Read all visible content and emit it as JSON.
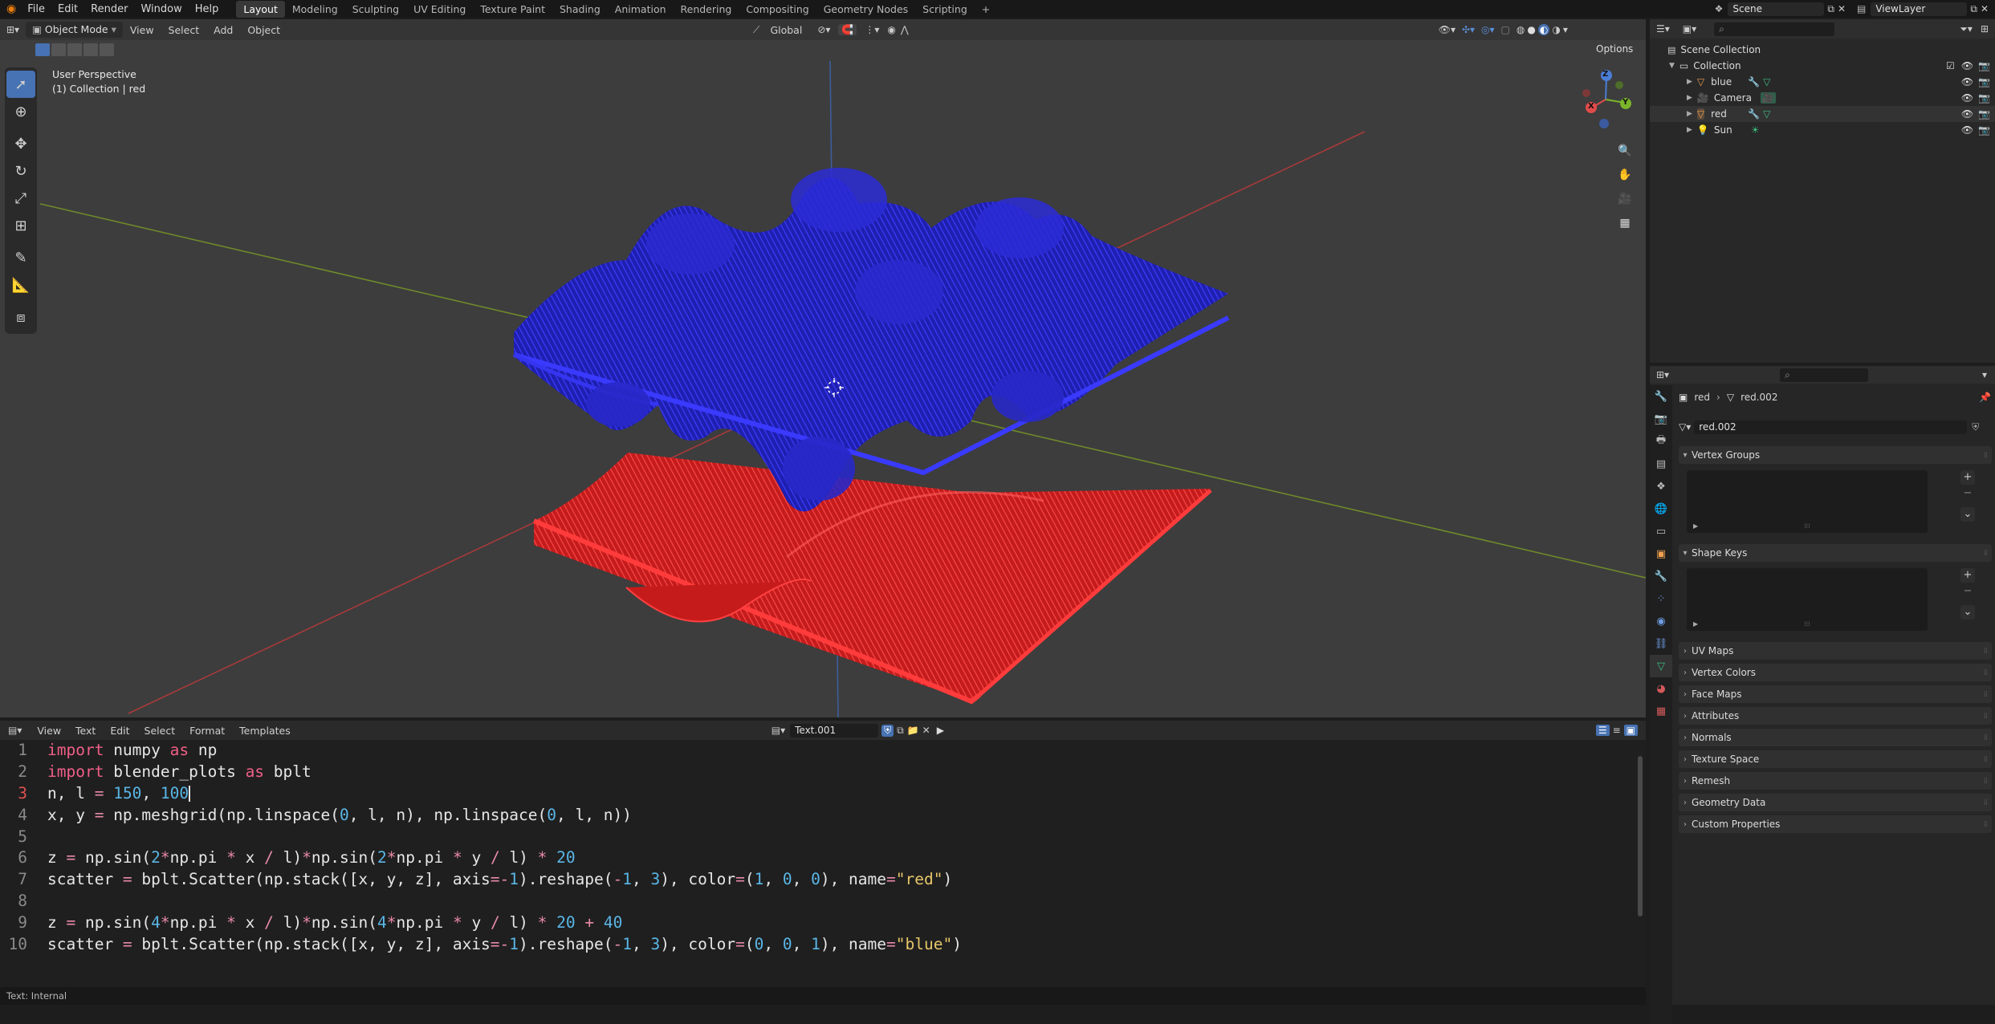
{
  "menu": {
    "items": [
      "File",
      "Edit",
      "Render",
      "Window",
      "Help"
    ],
    "workspaces": [
      "Layout",
      "Modeling",
      "Sculpting",
      "UV Editing",
      "Texture Paint",
      "Shading",
      "Animation",
      "Rendering",
      "Compositing",
      "Geometry Nodes",
      "Scripting"
    ],
    "active_workspace": "Layout",
    "add_tab": "+",
    "scene": "Scene",
    "view_layer": "ViewLayer"
  },
  "viewport": {
    "mode": "Object Mode",
    "menus": [
      "View",
      "Select",
      "Add",
      "Object"
    ],
    "transform_orientation": "Global",
    "options": "Options",
    "info_line1": "User Perspective",
    "info_line2": "(1) Collection | red",
    "gizmo": {
      "z": "Z",
      "y": "Y",
      "x": "X"
    },
    "colors": {
      "blue_mesh": "#2d2de0",
      "red_mesh": "#e02525",
      "background": "#3d3d3d"
    }
  },
  "text_editor": {
    "menus": [
      "View",
      "Text",
      "Edit",
      "Select",
      "Format",
      "Templates"
    ],
    "datablock": "Text.001",
    "status": "Text: Internal",
    "line_numbers": [
      "1",
      "2",
      "3",
      "4",
      "5",
      "6",
      "7",
      "8",
      "9",
      "10"
    ],
    "lines": [
      [
        [
          "kw",
          "import"
        ],
        [
          "plain",
          " numpy "
        ],
        [
          "kw",
          "as"
        ],
        [
          "plain",
          " np"
        ]
      ],
      [
        [
          "kw",
          "import"
        ],
        [
          "plain",
          " blender_plots "
        ],
        [
          "kw",
          "as"
        ],
        [
          "plain",
          " bplt"
        ]
      ],
      [
        [
          "plain",
          "n, l "
        ],
        [
          "op",
          "="
        ],
        [
          "plain",
          " "
        ],
        [
          "num",
          "150"
        ],
        [
          "plain",
          ", "
        ],
        [
          "num",
          "100"
        ]
      ],
      [
        [
          "plain",
          "x, y "
        ],
        [
          "op",
          "="
        ],
        [
          "plain",
          " np.meshgrid(np.linspace("
        ],
        [
          "num",
          "0"
        ],
        [
          "plain",
          ", l, n), np.linspace("
        ],
        [
          "num",
          "0"
        ],
        [
          "plain",
          ", l, n))"
        ]
      ],
      [],
      [
        [
          "plain",
          "z "
        ],
        [
          "op",
          "="
        ],
        [
          "plain",
          " np.sin("
        ],
        [
          "num",
          "2"
        ],
        [
          "op",
          "*"
        ],
        [
          "plain",
          "np.pi "
        ],
        [
          "op",
          "*"
        ],
        [
          "plain",
          " x "
        ],
        [
          "op",
          "/"
        ],
        [
          "plain",
          " l)"
        ],
        [
          "op",
          "*"
        ],
        [
          "plain",
          "np.sin("
        ],
        [
          "num",
          "2"
        ],
        [
          "op",
          "*"
        ],
        [
          "plain",
          "np.pi "
        ],
        [
          "op",
          "*"
        ],
        [
          "plain",
          " y "
        ],
        [
          "op",
          "/"
        ],
        [
          "plain",
          " l) "
        ],
        [
          "op",
          "*"
        ],
        [
          "plain",
          " "
        ],
        [
          "num",
          "20"
        ]
      ],
      [
        [
          "plain",
          "scatter "
        ],
        [
          "op",
          "="
        ],
        [
          "plain",
          " bplt.Scatter(np.stack([x, y, z], axis"
        ],
        [
          "op",
          "="
        ],
        [
          "op",
          "-"
        ],
        [
          "num",
          "1"
        ],
        [
          "plain",
          ").reshape("
        ],
        [
          "op",
          "-"
        ],
        [
          "num",
          "1"
        ],
        [
          "plain",
          ", "
        ],
        [
          "num",
          "3"
        ],
        [
          "plain",
          "), color"
        ],
        [
          "op",
          "="
        ],
        [
          "plain",
          "("
        ],
        [
          "num",
          "1"
        ],
        [
          "plain",
          ", "
        ],
        [
          "num",
          "0"
        ],
        [
          "plain",
          ", "
        ],
        [
          "num",
          "0"
        ],
        [
          "plain",
          "), name"
        ],
        [
          "op",
          "="
        ],
        [
          "str",
          "\"red\""
        ],
        [
          "plain",
          ")"
        ]
      ],
      [],
      [
        [
          "plain",
          "z "
        ],
        [
          "op",
          "="
        ],
        [
          "plain",
          " np.sin("
        ],
        [
          "num",
          "4"
        ],
        [
          "op",
          "*"
        ],
        [
          "plain",
          "np.pi "
        ],
        [
          "op",
          "*"
        ],
        [
          "plain",
          " x "
        ],
        [
          "op",
          "/"
        ],
        [
          "plain",
          " l)"
        ],
        [
          "op",
          "*"
        ],
        [
          "plain",
          "np.sin("
        ],
        [
          "num",
          "4"
        ],
        [
          "op",
          "*"
        ],
        [
          "plain",
          "np.pi "
        ],
        [
          "op",
          "*"
        ],
        [
          "plain",
          " y "
        ],
        [
          "op",
          "/"
        ],
        [
          "plain",
          " l) "
        ],
        [
          "op",
          "*"
        ],
        [
          "plain",
          " "
        ],
        [
          "num",
          "20"
        ],
        [
          "plain",
          " "
        ],
        [
          "op",
          "+"
        ],
        [
          "plain",
          " "
        ],
        [
          "num",
          "40"
        ]
      ],
      [
        [
          "plain",
          "scatter "
        ],
        [
          "op",
          "="
        ],
        [
          "plain",
          " bplt.Scatter(np.stack([x, y, z], axis"
        ],
        [
          "op",
          "="
        ],
        [
          "op",
          "-"
        ],
        [
          "num",
          "1"
        ],
        [
          "plain",
          ").reshape("
        ],
        [
          "op",
          "-"
        ],
        [
          "num",
          "1"
        ],
        [
          "plain",
          ", "
        ],
        [
          "num",
          "3"
        ],
        [
          "plain",
          "), color"
        ],
        [
          "op",
          "="
        ],
        [
          "plain",
          "("
        ],
        [
          "num",
          "0"
        ],
        [
          "plain",
          ", "
        ],
        [
          "num",
          "0"
        ],
        [
          "plain",
          ", "
        ],
        [
          "num",
          "1"
        ],
        [
          "plain",
          "), name"
        ],
        [
          "op",
          "="
        ],
        [
          "str",
          "\"blue\""
        ],
        [
          "plain",
          ")"
        ]
      ]
    ]
  },
  "outliner": {
    "scene_collection": "Scene Collection",
    "collection": "Collection",
    "objects": [
      "blue",
      "Camera",
      "red",
      "Sun"
    ]
  },
  "properties": {
    "object": "red",
    "mesh": "red.002",
    "mesh_field": "red.002",
    "vertex_groups": "Vertex Groups",
    "shape_keys": "Shape Keys",
    "panels": [
      "UV Maps",
      "Vertex Colors",
      "Face Maps",
      "Attributes",
      "Normals",
      "Texture Space",
      "Remesh",
      "Geometry Data",
      "Custom Properties"
    ]
  }
}
